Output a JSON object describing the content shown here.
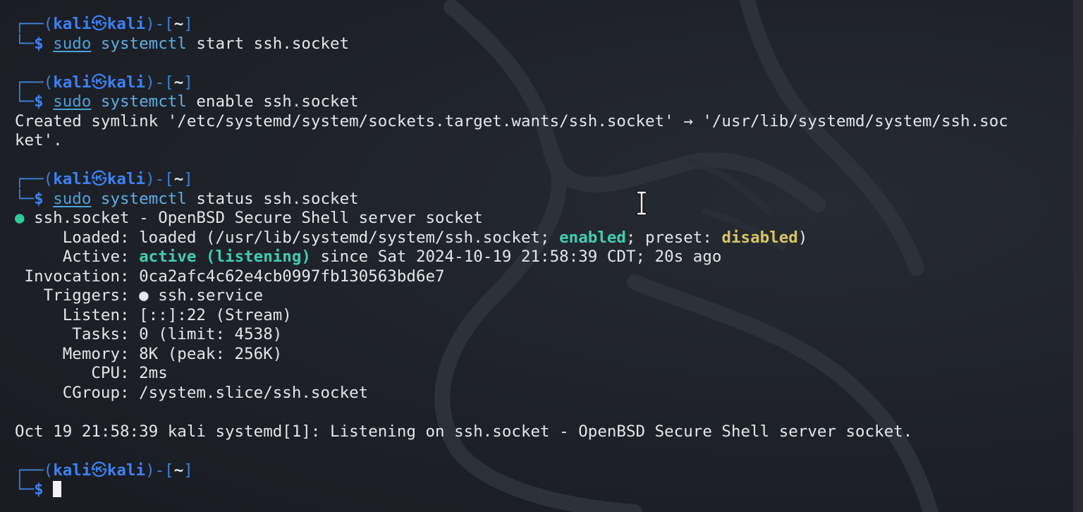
{
  "prompt": {
    "open": "┌──(",
    "user": "kali",
    "at_symbol": "㉿",
    "host": "kali",
    "mid": ")-[",
    "cwd": "~",
    "close": "]",
    "lower": "└─",
    "dollar": "$"
  },
  "commands": [
    {
      "sudo": "sudo",
      "prog": "systemctl",
      "args": "start ssh.socket"
    },
    {
      "sudo": "sudo",
      "prog": "systemctl",
      "args": "enable ssh.socket"
    },
    {
      "sudo": "sudo",
      "prog": "systemctl",
      "args": "status ssh.socket"
    }
  ],
  "enable_output": [
    "Created symlink '/etc/systemd/system/sockets.target.wants/ssh.socket' → '/usr/lib/systemd/system/ssh.soc",
    "ket'."
  ],
  "status": {
    "bullet": "●",
    "unit_line": "ssh.socket - OpenBSD Secure Shell server socket",
    "loaded_label": "     Loaded: ",
    "loaded_pre": "loaded (/usr/lib/systemd/system/ssh.socket; ",
    "loaded_enabled": "enabled",
    "loaded_mid": "; preset: ",
    "loaded_preset": "disabled",
    "loaded_end": ")",
    "active_label": "     Active: ",
    "active_state": "active (listening)",
    "active_rest": " since Sat 2024-10-19 21:58:39 CDT; 20s ago",
    "invocation": " Invocation: 0ca2afc4c62e4cb0997fb130563bd6e7",
    "triggers": "   Triggers: ● ssh.service",
    "listen": "     Listen: [::]:22 (Stream)",
    "tasks": "      Tasks: 0 (limit: 4538)",
    "memory": "     Memory: 8K (peak: 256K)",
    "cpu": "        CPU: 2ms",
    "cgroup": "     CGroup: /system.slice/ssh.socket",
    "journal": "Oct 19 21:58:39 kali systemd[1]: Listening on ssh.socket - OpenBSD Secure Shell server socket."
  },
  "colors": {
    "prompt_blue": "#3b82f6",
    "status_green": "#3ecfb0",
    "preset_yellow": "#d7c661",
    "background": "#1e2128"
  },
  "icons": {
    "cursor": "block-cursor-icon",
    "mouse_pointer": "text-ibeam-icon"
  }
}
